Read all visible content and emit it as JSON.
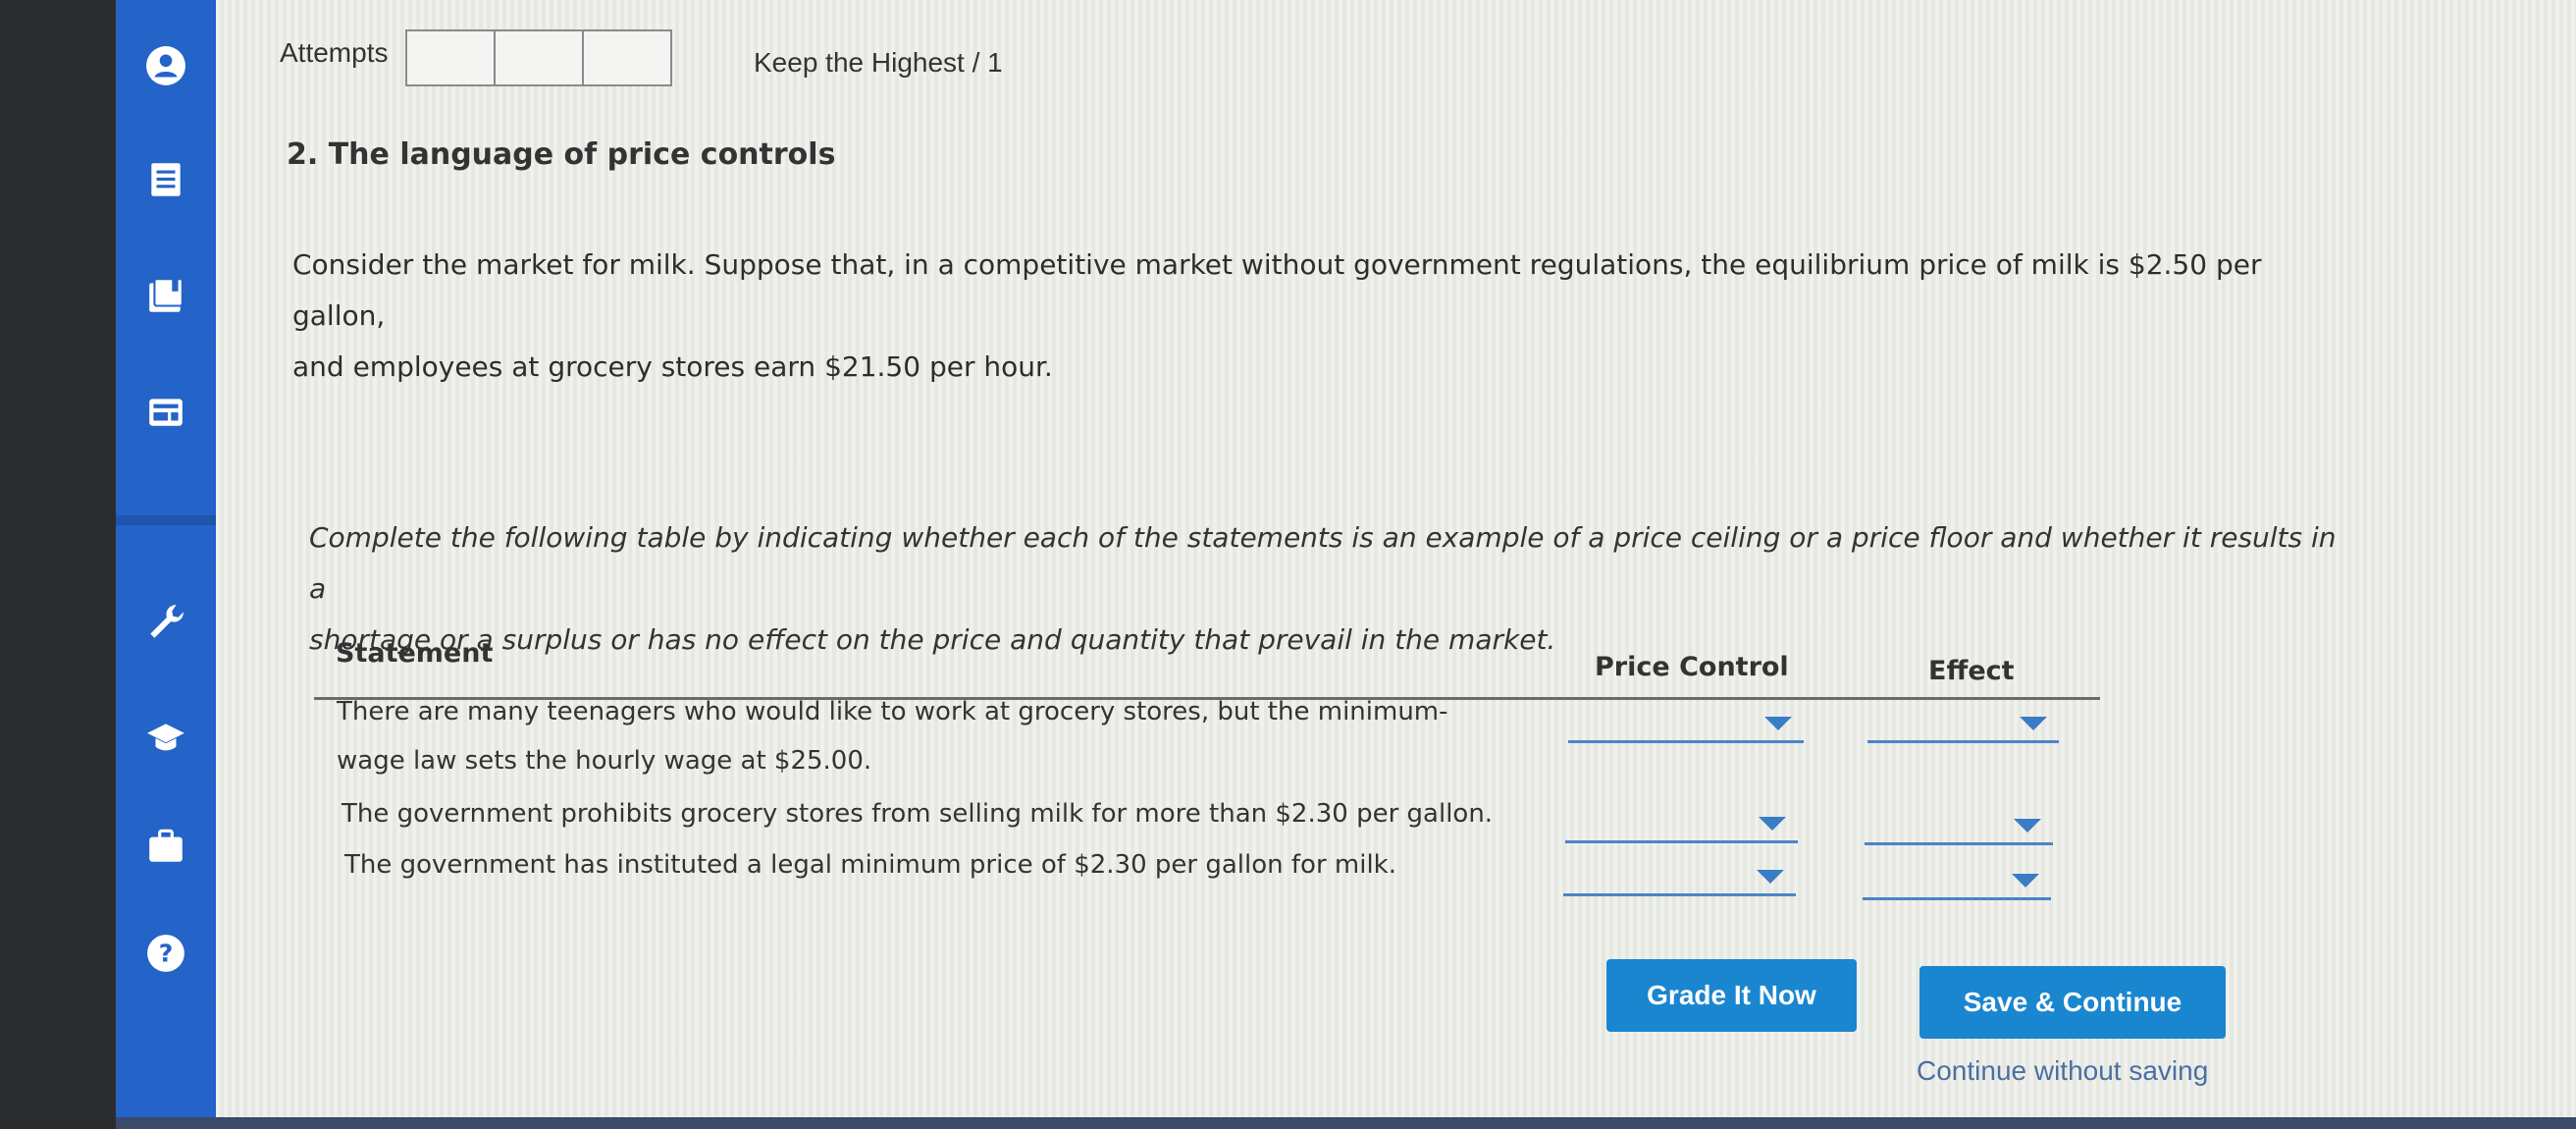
{
  "header": {
    "attempts_label": "Attempts",
    "keep_label": "Keep the Highest / 1"
  },
  "sidebar": {
    "icons": [
      "user-icon",
      "document-list-icon",
      "book-icon",
      "calendar-card-icon",
      "wrench-icon",
      "graduation-cap-icon",
      "briefcase-icon",
      "help-icon"
    ]
  },
  "question": {
    "title": "2. The language of price controls",
    "body_line1": "Consider the market for milk. Suppose that, in a competitive market without government regulations, the equilibrium price of milk is $2.50 per gallon,",
    "body_line2": "and employees at grocery stores earn $21.50 per hour.",
    "instructions_line1": "Complete the following table by indicating whether each of the statements is an example of a price ceiling or a price floor and whether it results in a",
    "instructions_line2": "shortage or a surplus or has no effect on the price and quantity that prevail in the market."
  },
  "table": {
    "col_statement": "Statement",
    "col_price_control": "Price Control",
    "col_effect": "Effect",
    "rows": [
      {
        "line1": "There are many teenagers who would like to work at grocery stores, but the minimum-",
        "line2": "wage law sets the hourly wage at $25.00.",
        "price_control": "",
        "effect": ""
      },
      {
        "line1": "The government prohibits grocery stores from selling milk for more than $2.30 per gallon.",
        "price_control": "",
        "effect": ""
      },
      {
        "line1": "The government has instituted a legal minimum price of $2.30 per gallon for milk.",
        "price_control": "",
        "effect": ""
      }
    ]
  },
  "actions": {
    "grade_label": "Grade It Now",
    "save_label": "Save & Continue",
    "continue_label": "Continue without saving"
  },
  "colors": {
    "sidebar": "#2463c8",
    "button": "#1a86d0",
    "dropdown_line": "#4a86c8"
  }
}
